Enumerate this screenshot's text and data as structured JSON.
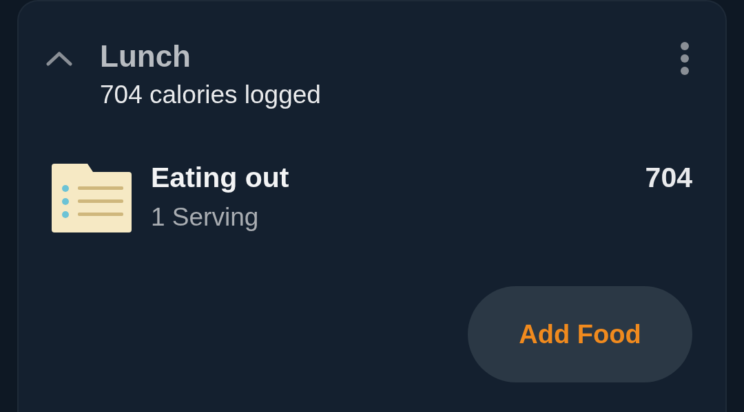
{
  "meal": {
    "title": "Lunch",
    "subtitle": "704 calories logged",
    "expanded": true
  },
  "entries": [
    {
      "name": "Eating out",
      "serving": "1 Serving",
      "calories": "704"
    }
  ],
  "add_button": "Add Food"
}
